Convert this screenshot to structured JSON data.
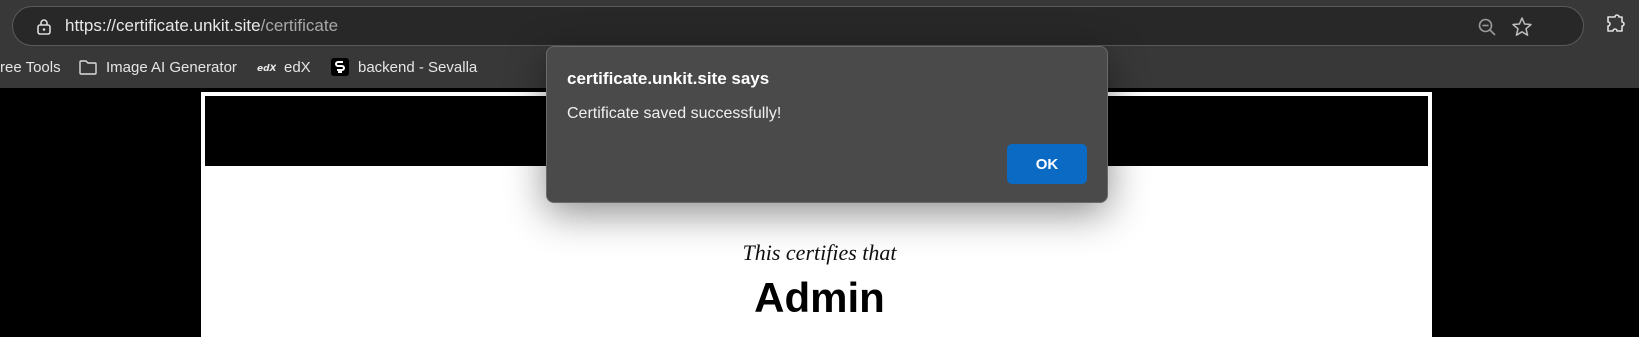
{
  "browser": {
    "url_host": "https://certificate.unkit.site",
    "url_path": "/certificate",
    "bookmarks": [
      {
        "label": "ree Tools",
        "icon": "partial"
      },
      {
        "label": "Image AI Generator",
        "icon": "folder-icon"
      },
      {
        "label": "edX",
        "icon": "edx-icon"
      },
      {
        "label": "backend - Sevalla",
        "icon": "sevalla-icon"
      }
    ]
  },
  "page": {
    "intro": "This certifies that",
    "name": "Admin"
  },
  "dialog": {
    "title": "certificate.unkit.site says",
    "message": "Certificate saved successfully!",
    "ok_label": "OK",
    "accent": "#0b6bc4"
  }
}
